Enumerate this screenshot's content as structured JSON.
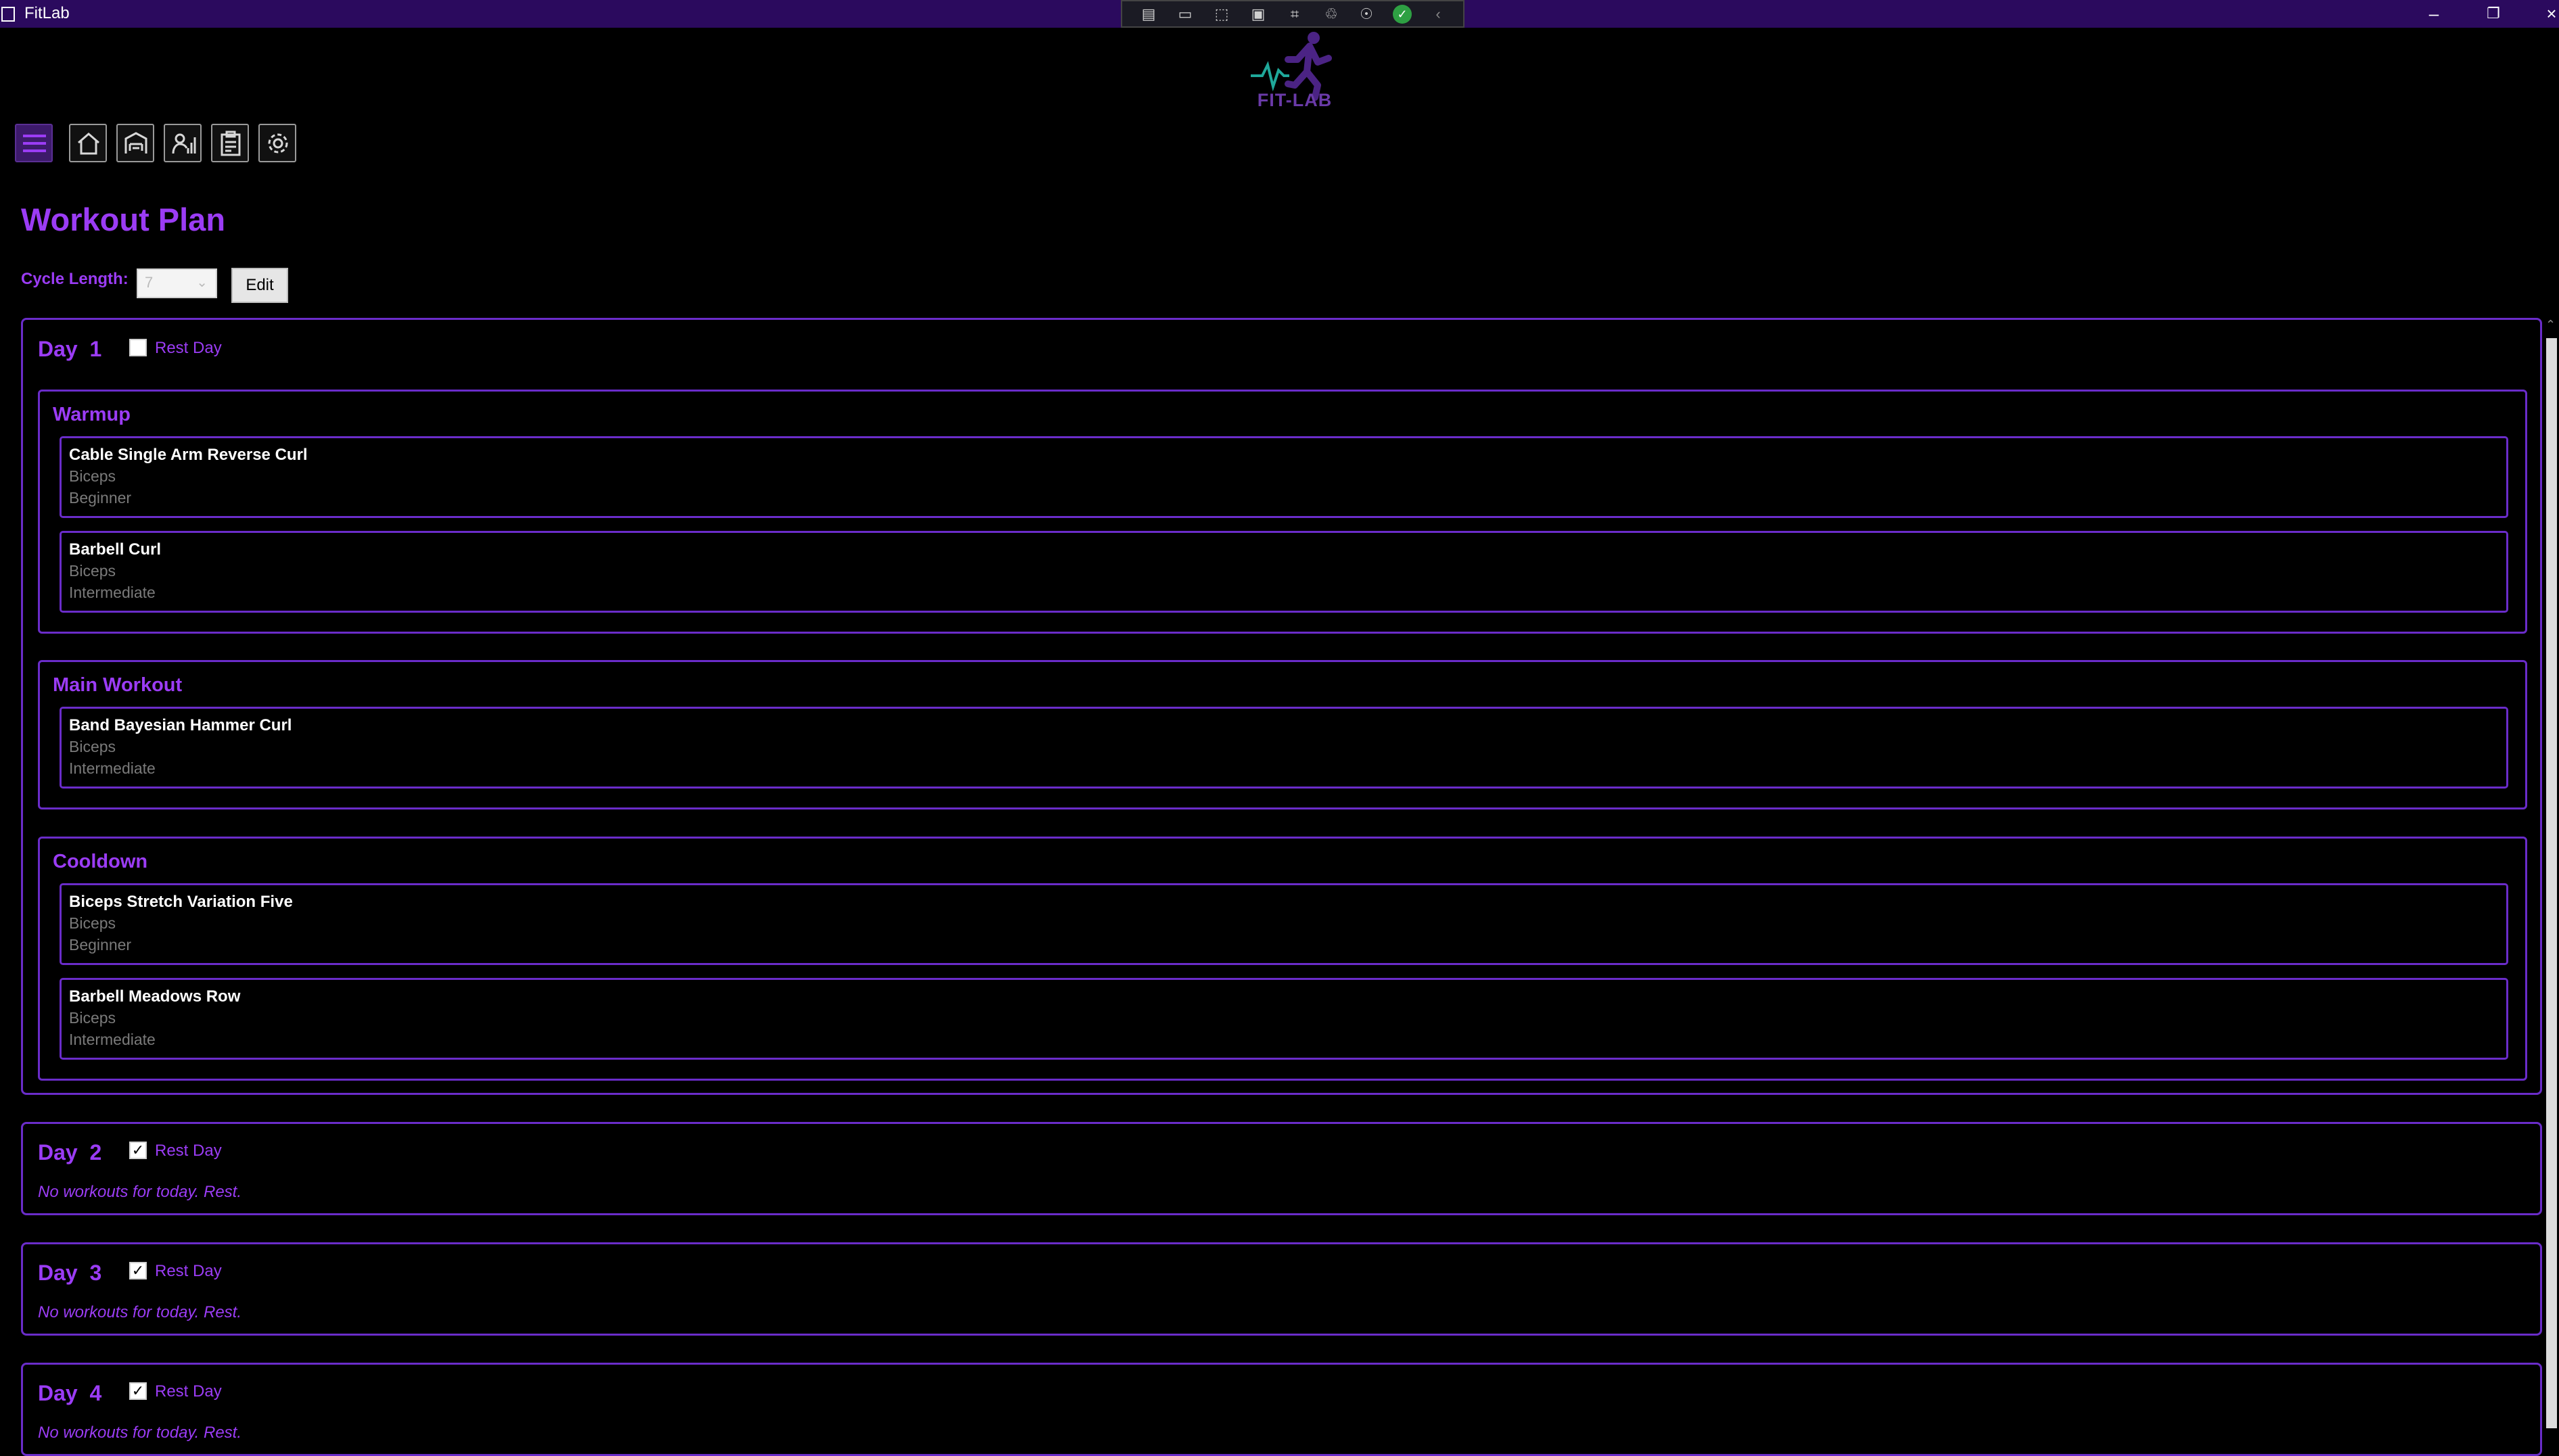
{
  "window": {
    "title": "FitLab"
  },
  "logo": {
    "text": "FIT-LAB"
  },
  "page": {
    "title": "Workout Plan"
  },
  "cycle": {
    "label": "Cycle Length:",
    "value": "7",
    "edit_label": "Edit"
  },
  "rest_day_label": "Rest Day",
  "days": [
    {
      "label": "Day",
      "number": "1",
      "rest_day": false,
      "sections": [
        {
          "title": "Warmup",
          "exercises": [
            {
              "name": "Cable Single Arm Reverse Curl",
              "muscle": "Biceps",
              "level": "Beginner"
            },
            {
              "name": "Barbell Curl",
              "muscle": "Biceps",
              "level": "Intermediate"
            }
          ]
        },
        {
          "title": "Main Workout",
          "exercises": [
            {
              "name": "Band Bayesian Hammer Curl",
              "muscle": "Biceps",
              "level": "Intermediate"
            }
          ]
        },
        {
          "title": "Cooldown",
          "exercises": [
            {
              "name": "Biceps Stretch Variation Five",
              "muscle": "Biceps",
              "level": "Beginner"
            },
            {
              "name": "Barbell Meadows Row",
              "muscle": "Biceps",
              "level": "Intermediate"
            }
          ]
        }
      ]
    },
    {
      "label": "Day",
      "number": "2",
      "rest_day": true,
      "rest_message": "No workouts for today. Rest."
    },
    {
      "label": "Day",
      "number": "3",
      "rest_day": true,
      "rest_message": "No workouts for today. Rest."
    },
    {
      "label": "Day",
      "number": "4",
      "rest_day": true,
      "rest_message": "No workouts for today. Rest."
    }
  ],
  "nav": {
    "items": [
      "menu-icon",
      "home-icon",
      "gym-icon",
      "progress-icon",
      "clipboard-icon",
      "settings-icon"
    ]
  },
  "colors": {
    "accent": "#9b3cf5",
    "border": "#6a2cc9",
    "titlebar": "#2b0a5e",
    "background": "#000000"
  }
}
